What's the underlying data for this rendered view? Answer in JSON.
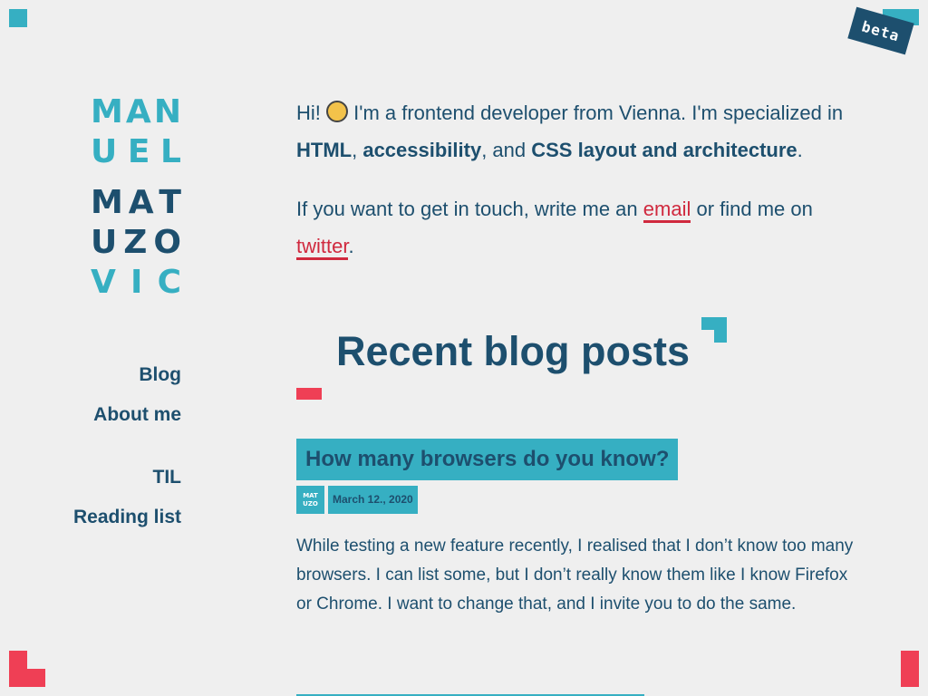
{
  "badge": {
    "label": "beta"
  },
  "logo": {
    "first_name_lines": [
      [
        "M",
        "A",
        "N"
      ],
      [
        "U",
        "E",
        "L"
      ]
    ],
    "last_name_lines": [
      [
        "M",
        "A",
        "T"
      ],
      [
        "U",
        "Z",
        "O"
      ],
      [
        "V",
        "I",
        "C"
      ]
    ]
  },
  "nav": {
    "blog": "Blog",
    "about": "About me",
    "til": "TIL",
    "reading": "Reading list"
  },
  "intro": {
    "hi": "Hi!",
    "sentence1": " I'm a frontend developer from Vienna. I'm specialized in ",
    "skill1": "HTML",
    "comma1": ", ",
    "skill2": "accessibility",
    "and": ", and ",
    "skill3": "CSS layout and architecture",
    "period": ".",
    "contact_pre": "If you want to get in touch, write me an ",
    "email_link": "email",
    "contact_mid": " or find me on ",
    "twitter_link": "twitter",
    "contact_end": "."
  },
  "section": {
    "heading": "Recent blog posts"
  },
  "post": {
    "title": "How many browsers do you know?",
    "mini_logo_top": "MAT",
    "mini_logo_bottom": "UZO",
    "date": "March 12., 2020",
    "excerpt": "While testing a new feature recently, I realised that I don’t know too many browsers. I can list some, but I don’t really know them like I know Firefox or Chrome. I want to change that, and I invite you to do the same."
  },
  "colors": {
    "background": "#efefef",
    "navy": "#1d4f6e",
    "teal": "#36afc2",
    "red": "#ef3f55",
    "link": "#d0293e"
  }
}
